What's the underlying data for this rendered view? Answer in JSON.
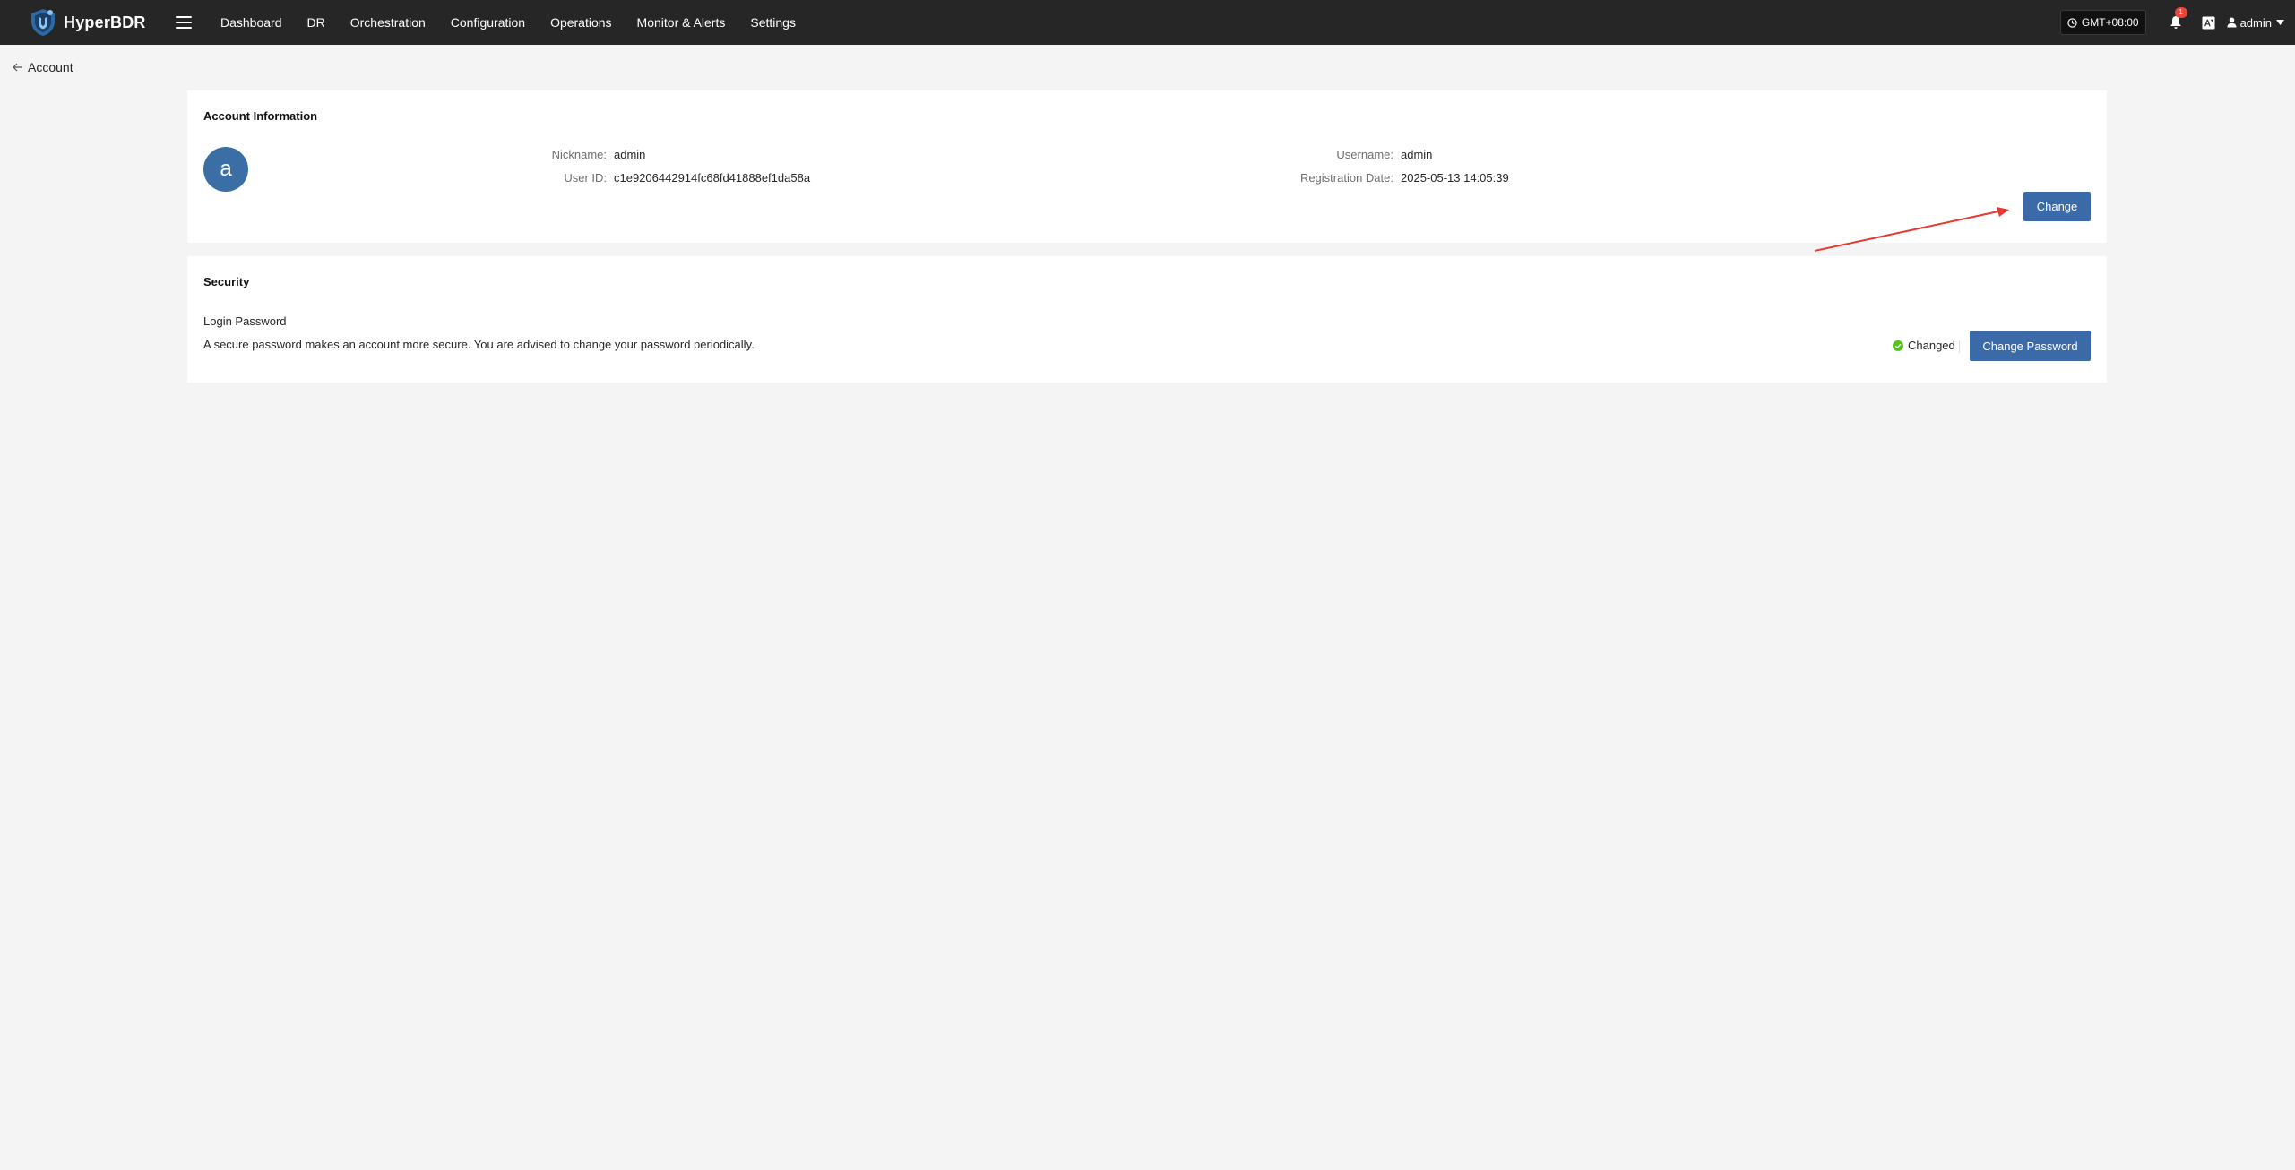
{
  "app": {
    "brand_name": "HyperBDR",
    "accent_color": "#3a6ba8"
  },
  "nav": {
    "items": [
      {
        "label": "Dashboard"
      },
      {
        "label": "DR"
      },
      {
        "label": "Orchestration"
      },
      {
        "label": "Configuration"
      },
      {
        "label": "Operations"
      },
      {
        "label": "Monitor & Alerts"
      },
      {
        "label": "Settings"
      }
    ]
  },
  "header_tools": {
    "timezone": "GMT+08:00",
    "notification_count": "1",
    "user_name": "admin",
    "icons": [
      "clock-icon",
      "bell-icon",
      "language-icon",
      "user-icon",
      "caret-down-icon"
    ]
  },
  "page": {
    "back_label": "Account"
  },
  "account_info": {
    "title": "Account Information",
    "avatar_letter": "a",
    "nickname_label": "Nickname:",
    "nickname_value": "admin",
    "user_id_label": "User ID:",
    "user_id_value": "c1e9206442914fc68fd41888ef1da58a",
    "username_label": "Username:",
    "username_value": "admin",
    "reg_date_label": "Registration Date:",
    "reg_date_value": "2025-05-13 14:05:39",
    "change_button": "Change"
  },
  "security": {
    "title": "Security",
    "login_password_label": "Login Password",
    "description": "A secure password makes an account more secure. You are advised to change your password periodically.",
    "status_text": "Changed",
    "status_color": "#52c41a",
    "change_password_button": "Change Password"
  },
  "annotation": {
    "arrow_color": "#e8382f"
  }
}
